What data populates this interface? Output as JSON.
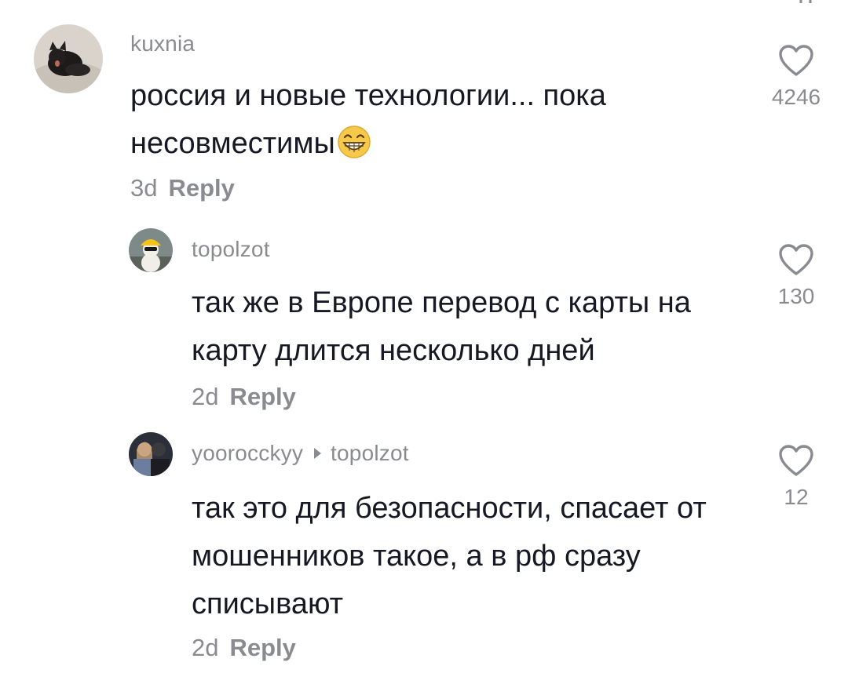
{
  "comments": [
    {
      "username": "kuxnia",
      "text": "россия и новые технологии... пока несовместимы",
      "emoji": "grinning-face-emoji",
      "time": "3d",
      "reply_label": "Reply",
      "likes": "4246"
    },
    {
      "username": "topolzot",
      "text": "так же в Европе перевод с карты на карту длится несколько дней",
      "time": "2d",
      "reply_label": "Reply",
      "likes": "130"
    },
    {
      "username": "yoorocckyy",
      "reply_to": "topolzot",
      "text": "так это для безопасности, спасает от мошенников такое, а в рф сразу списывают",
      "time": "2d",
      "reply_label": "Reply",
      "likes": "12"
    }
  ],
  "icons": {
    "like": "heart-outline-icon",
    "reply_arrow": "right-triangle-icon"
  },
  "colors": {
    "text": "#161823",
    "secondary": "#8a8b91",
    "background": "#ffffff"
  }
}
